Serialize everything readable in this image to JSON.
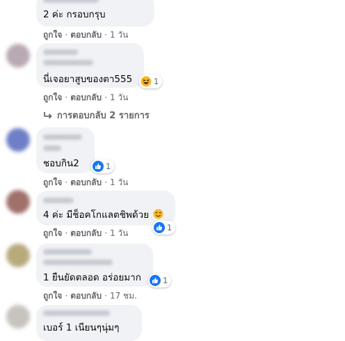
{
  "comments": [
    {
      "text": "2 ค่ะ กรอบกรุบ",
      "like": "ถูกใจ",
      "reply": "ตอบกลับ",
      "time": "1 วัน"
    },
    {
      "text": "นี่เจอยาสูบของตา555",
      "reaction_count": "1",
      "reaction_icon": "haha-emoji",
      "like": "ถูกใจ",
      "reply": "ตอบกลับ",
      "time": "1 วัน",
      "replies_link": "การตอบกลับ 2 รายการ"
    },
    {
      "text": "ชอบกิน2",
      "reaction_count": "1",
      "reaction_icon": "like-thumb",
      "like": "ถูกใจ",
      "reply": "ตอบกลับ",
      "time": "1 วัน"
    },
    {
      "text": "4 ค่ะ มีช็อคโกแลตชิพด้วย",
      "emoji": "smile-emoji",
      "reaction_count": "1",
      "reaction_icon": "like-thumb",
      "like": "ถูกใจ",
      "reply": "ตอบกลับ",
      "time": "1 วัน"
    },
    {
      "text": "1 ยืนยัดตลอด อร่อยมาก",
      "reaction_count": "1",
      "reaction_icon": "like-thumb",
      "like": "ถูกใจ",
      "reply": "ตอบกลับ",
      "time": "17 ชม."
    },
    {
      "text": "เบอร์ 1 เนียนๆนุ่มๆ"
    }
  ],
  "colors": {
    "bubble": "#f0f2f5",
    "meta": "#65676b",
    "like_blue": "#1877f2",
    "haha_yellow": "#f7b928"
  }
}
